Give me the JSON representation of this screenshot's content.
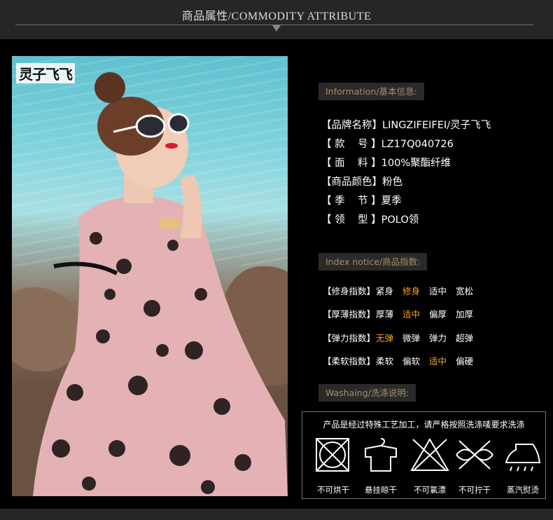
{
  "header": {
    "title": "商品属性/COMMODITY ATTRIBUTE"
  },
  "photo": {
    "logo": "灵子飞飞"
  },
  "info": {
    "tag": "Information/基本信息:",
    "rows": [
      "【品牌名称】LINGZIFEIFEI/灵子飞飞",
      "【 款    号 】LZ17Q040726",
      "【 面    料 】100%聚酯纤维",
      "【商品颜色】粉色",
      "【 季    节 】夏季",
      "【 领    型 】POLO领"
    ]
  },
  "index": {
    "tag": "Index notice/商品指数:",
    "rows": [
      {
        "label": "【修身指数】",
        "options": [
          "紧身",
          "修身",
          "适中",
          "宽松"
        ],
        "selected": 1
      },
      {
        "label": "【厚薄指数】",
        "options": [
          "厚薄",
          "适中",
          "偏厚",
          "加厚"
        ],
        "selected": 1
      },
      {
        "label": "【弹力指数】",
        "options": [
          "无弹",
          "微弹",
          "弹力",
          "超弹"
        ],
        "selected": 0
      },
      {
        "label": "【柔软指数】",
        "options": [
          "柔软",
          "偏软",
          "适中",
          "偏硬"
        ],
        "selected": 2
      }
    ],
    "highlight_color": "#f5a623"
  },
  "washing": {
    "tag": "Washaing/洗涤说明:",
    "note": "产品是经过特殊工艺加工，请严格按照洗涤唛要求洗涤",
    "items": [
      {
        "label": "不可烘干",
        "icon": "no-tumble-dry-icon"
      },
      {
        "label": "悬挂晾干",
        "icon": "hang-dry-icon"
      },
      {
        "label": "不可氯漂",
        "icon": "no-bleach-icon"
      },
      {
        "label": "不可拧干",
        "icon": "no-wring-icon"
      },
      {
        "label": "蒸汽熨烫",
        "icon": "steam-iron-icon"
      }
    ]
  }
}
